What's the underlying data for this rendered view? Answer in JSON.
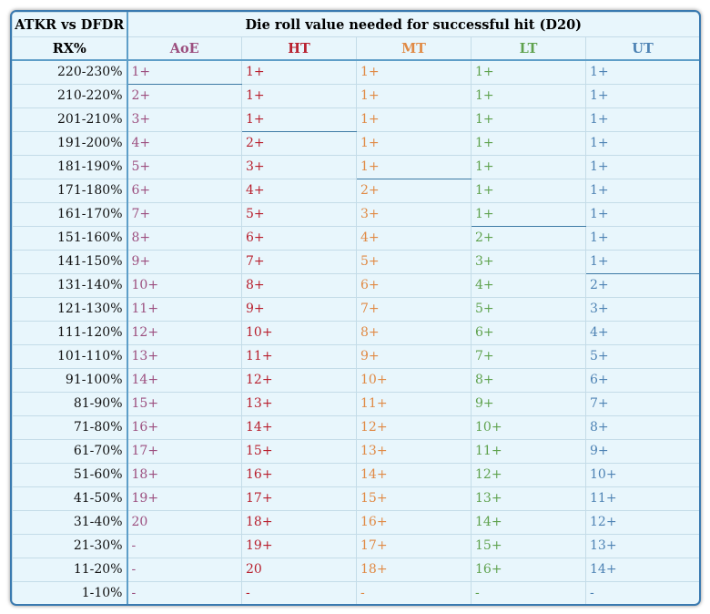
{
  "header": {
    "corner": "ATKR vs DFDR",
    "span_title": "Die roll value needed for successful hit (D20)",
    "row_label": "RX%",
    "columns": [
      {
        "key": "aoe",
        "label": "AoE",
        "color": "#9c4f7f"
      },
      {
        "key": "ht",
        "label": "HT",
        "color": "#b8202e"
      },
      {
        "key": "mt",
        "label": "MT",
        "color": "#e08a45"
      },
      {
        "key": "lt",
        "label": "LT",
        "color": "#5fa24e"
      },
      {
        "key": "ut",
        "label": "UT",
        "color": "#4e83b4"
      }
    ]
  },
  "rows": [
    {
      "rx": "220-230%",
      "values": [
        "1+",
        "1+",
        "1+",
        "1+",
        "1+"
      ]
    },
    {
      "rx": "210-220%",
      "values": [
        "2+",
        "1+",
        "1+",
        "1+",
        "1+"
      ]
    },
    {
      "rx": "201-210%",
      "values": [
        "3+",
        "1+",
        "1+",
        "1+",
        "1+"
      ]
    },
    {
      "rx": "191-200%",
      "values": [
        "4+",
        "2+",
        "1+",
        "1+",
        "1+"
      ]
    },
    {
      "rx": "181-190%",
      "values": [
        "5+",
        "3+",
        "1+",
        "1+",
        "1+"
      ]
    },
    {
      "rx": "171-180%",
      "values": [
        "6+",
        "4+",
        "2+",
        "1+",
        "1+"
      ]
    },
    {
      "rx": "161-170%",
      "values": [
        "7+",
        "5+",
        "3+",
        "1+",
        "1+"
      ]
    },
    {
      "rx": "151-160%",
      "values": [
        "8+",
        "6+",
        "4+",
        "2+",
        "1+"
      ]
    },
    {
      "rx": "141-150%",
      "values": [
        "9+",
        "7+",
        "5+",
        "3+",
        "1+"
      ]
    },
    {
      "rx": "131-140%",
      "values": [
        "10+",
        "8+",
        "6+",
        "4+",
        "2+"
      ]
    },
    {
      "rx": "121-130%",
      "values": [
        "11+",
        "9+",
        "7+",
        "5+",
        "3+"
      ]
    },
    {
      "rx": "111-120%",
      "values": [
        "12+",
        "10+",
        "8+",
        "6+",
        "4+"
      ]
    },
    {
      "rx": "101-110%",
      "values": [
        "13+",
        "11+",
        "9+",
        "7+",
        "5+"
      ]
    },
    {
      "rx": "91-100%",
      "values": [
        "14+",
        "12+",
        "10+",
        "8+",
        "6+"
      ]
    },
    {
      "rx": "81-90%",
      "values": [
        "15+",
        "13+",
        "11+",
        "9+",
        "7+"
      ]
    },
    {
      "rx": "71-80%",
      "values": [
        "16+",
        "14+",
        "12+",
        "10+",
        "8+"
      ]
    },
    {
      "rx": "61-70%",
      "values": [
        "17+",
        "15+",
        "13+",
        "11+",
        "9+"
      ]
    },
    {
      "rx": "51-60%",
      "values": [
        "18+",
        "16+",
        "14+",
        "12+",
        "10+"
      ]
    },
    {
      "rx": "41-50%",
      "values": [
        "19+",
        "17+",
        "15+",
        "13+",
        "11+"
      ]
    },
    {
      "rx": "31-40%",
      "values": [
        "20",
        "18+",
        "16+",
        "14+",
        "12+"
      ]
    },
    {
      "rx": "21-30%",
      "values": [
        "-",
        "19+",
        "17+",
        "15+",
        "13+"
      ]
    },
    {
      "rx": "11-20%",
      "values": [
        "-",
        "20",
        "18+",
        "16+",
        "14+"
      ]
    },
    {
      "rx": "1-10%",
      "values": [
        "-",
        "-",
        "-",
        "-",
        "-"
      ]
    }
  ]
}
